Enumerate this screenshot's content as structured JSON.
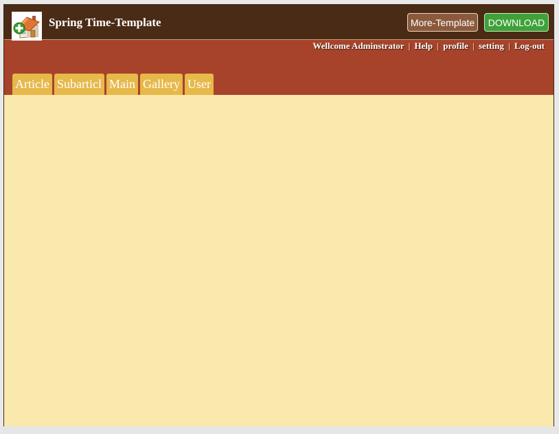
{
  "header": {
    "title": "Spring Time-Template",
    "logo_icon": "house-icon",
    "buttons": {
      "more_template": "More-Template",
      "download": "DOWNLOAD"
    }
  },
  "user_bar": {
    "welcome": "Wellcome Adminstrator",
    "links": {
      "help": "Help",
      "profile": "profile",
      "setting": "setting",
      "logout": "Log-out"
    },
    "separator": "|"
  },
  "tabs": [
    {
      "label": "Article"
    },
    {
      "label": "Subarticl"
    },
    {
      "label": "Main"
    },
    {
      "label": "Gallery"
    },
    {
      "label": "User"
    }
  ],
  "colors": {
    "topbar": "#4a2b16",
    "navbar": "#a7432a",
    "tab": "#e7b84a",
    "content": "#f9e9ad",
    "more_button": "#8b5a3c",
    "download_button": "#3fa138"
  }
}
